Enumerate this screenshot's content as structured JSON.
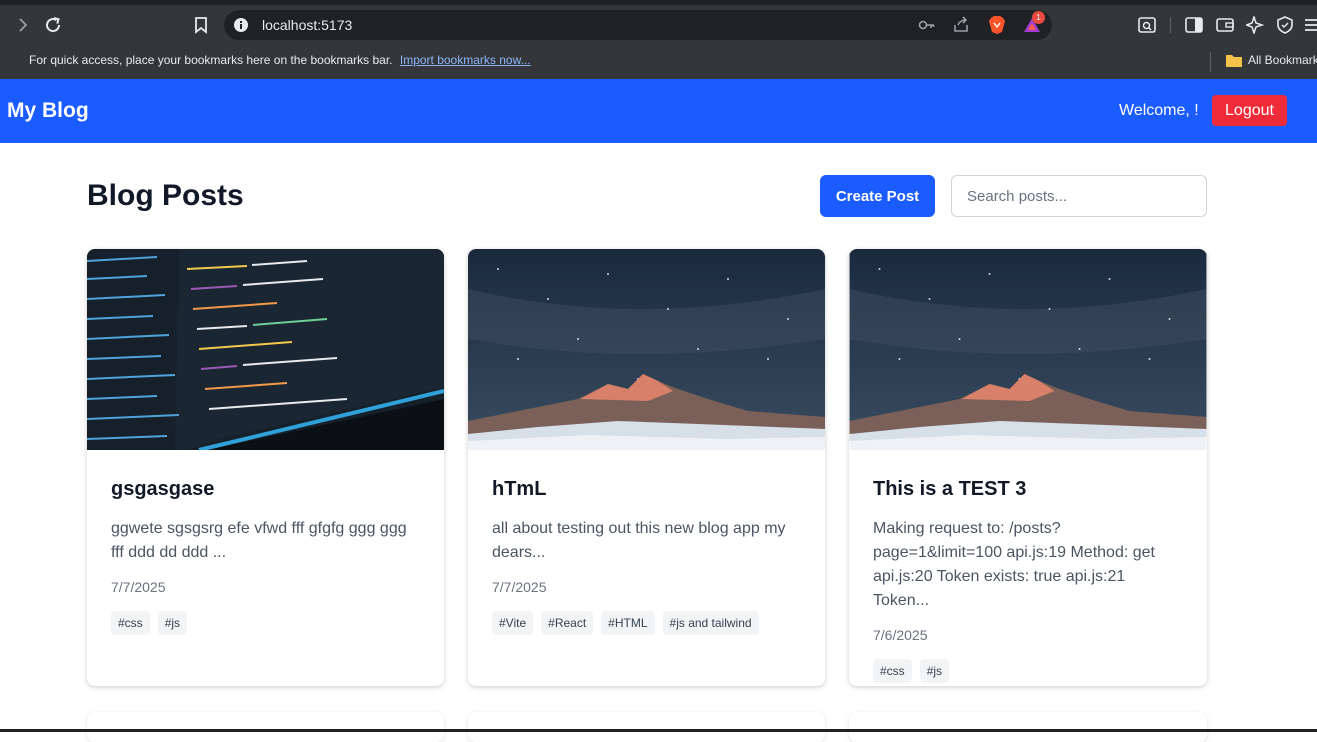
{
  "browser": {
    "url": "localhost:5173",
    "bookmarks_bar_text": "For quick access, place your bookmarks here on the bookmarks bar.",
    "import_bookmarks_link": "Import bookmarks now...",
    "all_bookmarks_label": "All Bookmarks",
    "notification_badge": "1"
  },
  "header": {
    "brand": "My Blog",
    "welcome": "Welcome, !",
    "logout_label": "Logout",
    "accent_color": "#1a5cff",
    "logout_color": "#ef2b3a"
  },
  "main": {
    "title": "Blog Posts",
    "create_label": "Create Post",
    "search_placeholder": "Search posts..."
  },
  "posts": [
    {
      "title": "gsgasgase",
      "excerpt": "ggwete sgsgsrg efe vfwd fff gfgfg ggg ggg fff ddd dd ddd ...",
      "date": "7/7/2025",
      "tags": [
        "#css",
        "#js"
      ],
      "image": "code-screen"
    },
    {
      "title": "hTmL",
      "excerpt": "all about testing out this new blog app my dears...",
      "date": "7/7/2025",
      "tags": [
        "#Vite",
        "#React",
        "#HTML",
        "#js and tailwind"
      ],
      "image": "starry-mountain"
    },
    {
      "title": "This is a TEST 3",
      "excerpt": "Making request to: /posts?page=1&limit=100 api.js:19 Method: get api.js:20 Token exists: true api.js:21 Token...",
      "date": "7/6/2025",
      "tags": [
        "#css",
        "#js"
      ],
      "image": "starry-mountain"
    }
  ]
}
